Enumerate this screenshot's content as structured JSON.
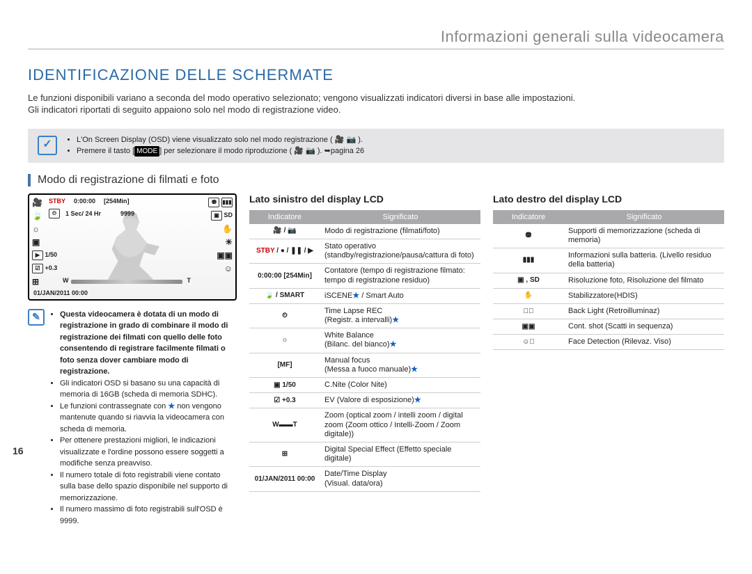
{
  "page_number": "16",
  "chapter_title": "Informazioni generali sulla videocamera",
  "section_title": "IDENTIFICAZIONE DELLE SCHERMATE",
  "intro_l1": "Le funzioni disponibili variano a seconda del modo operativo selezionato; vengono visualizzati indicatori diversi in base alle impostazioni.",
  "intro_l2": "Gli indicatori riportati di seguito appaiono solo nel modo di registrazione video.",
  "infobox": {
    "bullets": [
      "L'On Screen Display (OSD) viene visualizzato solo nel modo registrazione ( 🎥 📷 ).",
      "Premere il tasto [MODE] per selezionare il modo riproduzione ( 🎥 📷 ). ➥pagina 26"
    ],
    "mode_key": "MODE"
  },
  "subsection_title": "Modo di registrazione di filmati e foto",
  "lcd": {
    "stby": "STBY",
    "time": "0:00:00",
    "remain": "254Min",
    "interval": "1 Sec/ 24 Hr",
    "photos": "9999",
    "cnite": "1/50",
    "ev": "+0.3",
    "date": "01/JAN/2011 00:00",
    "sd": "SD"
  },
  "notes": [
    "Questa videocamera è dotata di un modo di registrazione in grado di combinare il modo di registrazione dei filmati con quello delle foto consentendo di registrare facilmente filmati o foto senza dover cambiare modo di registrazione.",
    "Gli indicatori OSD si basano su una capacità di memoria di 16GB (scheda di memoria SDHC).",
    "Le funzioni contrassegnate con ★ non vengono mantenute quando si riavvia la videocamera con scheda di memoria.",
    "Per ottenere prestazioni migliori, le indicazioni visualizzate e l'ordine possono essere soggetti a modifiche senza preavviso.",
    "Il numero totale di foto registrabili viene contato sulla base dello spazio disponibile nel supporto di memorizzazione.",
    "Il numero massimo di foto registrabili sull'OSD è 9999."
  ],
  "left_table": {
    "title": "Lato sinistro del display LCD",
    "h1": "Indicatore",
    "h2": "Significato",
    "rows": [
      {
        "ind": "🎥 / 📷",
        "sig": "Modo di registrazione (filmati/foto)"
      },
      {
        "ind": "STBY / ● / ❚❚ / ▶",
        "sig": "Stato operativo (standby/registrazione/pausa/cattura di foto)",
        "stby": true
      },
      {
        "ind": "0:00:00 [254Min]",
        "sig": "Contatore (tempo di registrazione filmato: tempo di registrazione residuo)"
      },
      {
        "ind": "🍃 / SMART",
        "sig": "iSCENE★ / Smart Auto"
      },
      {
        "ind": "⏲",
        "sig": "Time Lapse REC\n(Registr. a intervalli)★"
      },
      {
        "ind": "☼",
        "sig": "White Balance\n(Bilanc. del bianco)★"
      },
      {
        "ind": "[MF]",
        "sig": "Manual focus\n(Messa a fuoco manuale)★"
      },
      {
        "ind": "▣ 1/50",
        "sig": "C.Nite (Color Nite)"
      },
      {
        "ind": "☑ +0.3",
        "sig": "EV (Valore di esposizione)★"
      },
      {
        "ind": "W▬▬T",
        "sig": "Zoom (optical zoom / intelli zoom / digital zoom (Zoom ottico / Intelli-Zoom / Zoom digitale))"
      },
      {
        "ind": "⊞",
        "sig": "Digital Special Effect (Effetto speciale digitale)"
      },
      {
        "ind": "01/JAN/2011 00:00",
        "sig": "Date/Time Display\n(Visual. data/ora)"
      }
    ]
  },
  "right_table": {
    "title": "Lato destro del display LCD",
    "h1": "Indicatore",
    "h2": "Significato",
    "rows": [
      {
        "ind": "⛃",
        "sig": "Supporti di memorizzazione (scheda di memoria)"
      },
      {
        "ind": "▮▮▮",
        "sig": "Informazioni sulla batteria. (Livello residuo della batteria)"
      },
      {
        "ind": "▣ , SD",
        "sig": "Risoluzione foto, Risoluzione del filmato"
      },
      {
        "ind": "✋",
        "sig": "Stabilizzatore(HDIS)"
      },
      {
        "ind": "☀⃞",
        "sig": "Back Light (Retroilluminaz)"
      },
      {
        "ind": "▣▣",
        "sig": "Cont. shot (Scatti in sequenza)"
      },
      {
        "ind": "☺⃞",
        "sig": "Face Detection (Rilevaz. Viso)"
      }
    ]
  }
}
